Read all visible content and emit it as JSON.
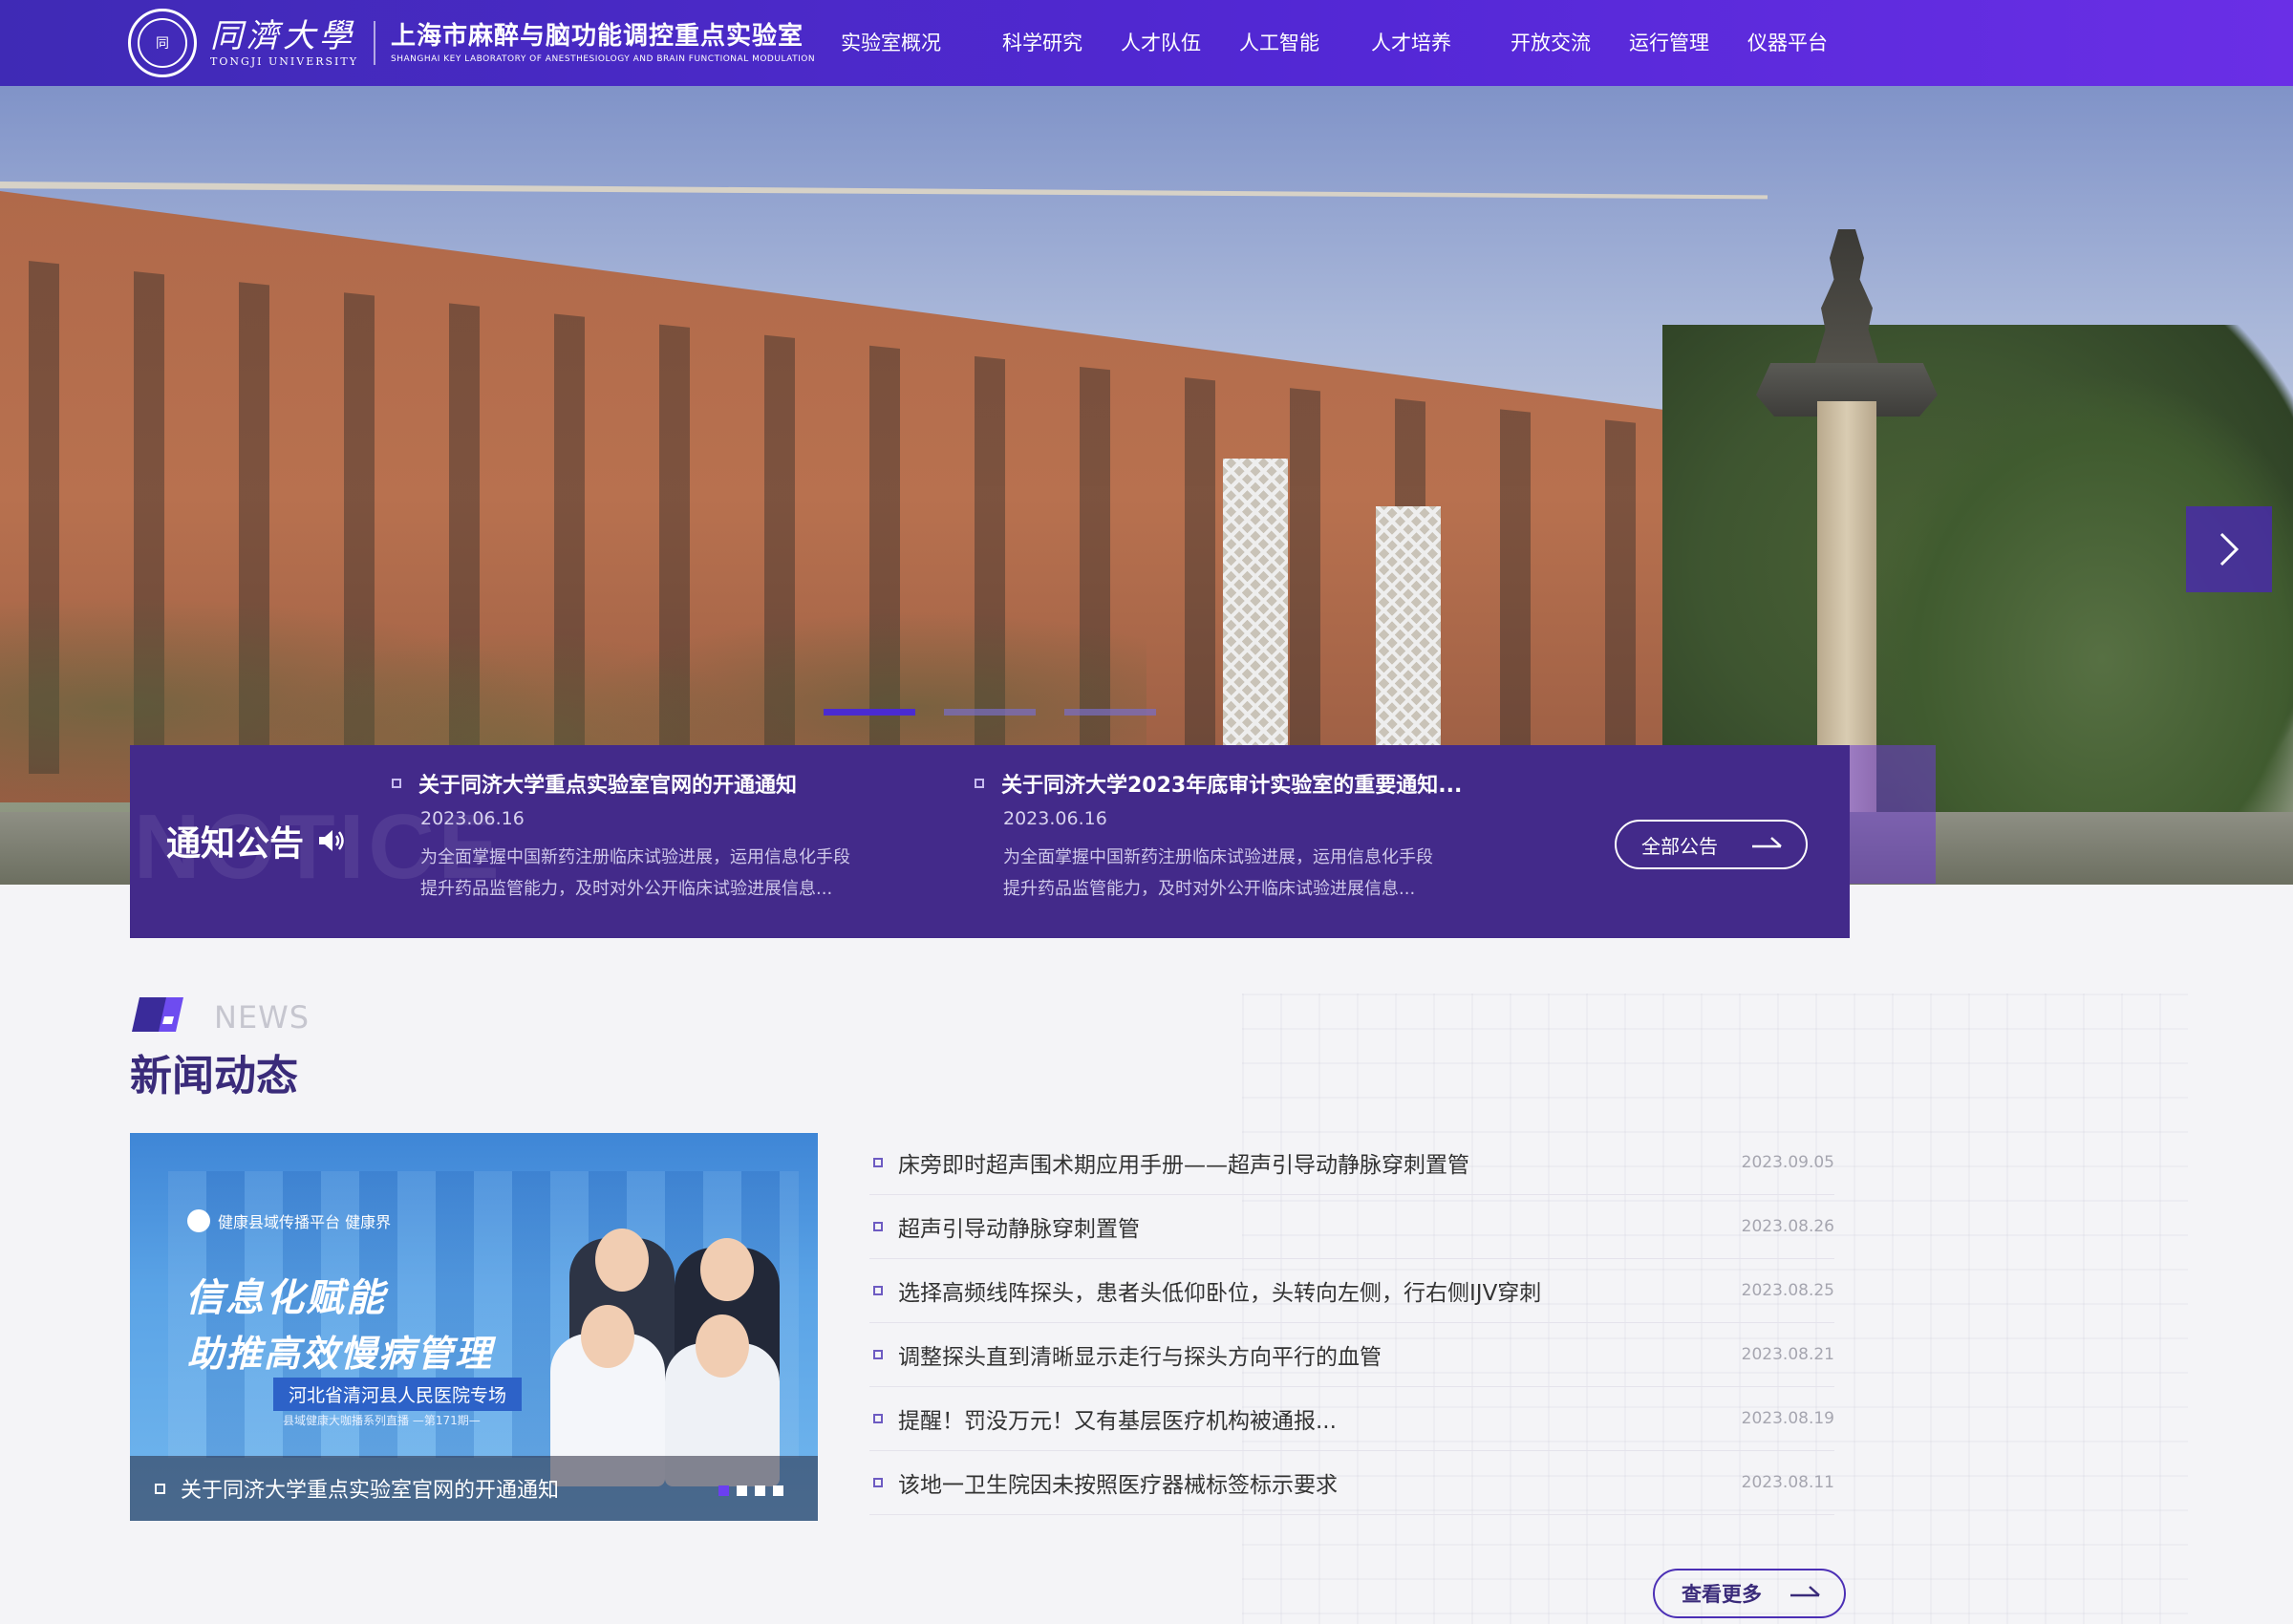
{
  "header": {
    "uni_cn": "同濟大學",
    "uni_en": "TONGJI UNIVERSITY",
    "lab_cn": "上海市麻醉与脑功能调控重点实验室",
    "lab_en": "SHANGHAI KEY LABORATORY OF ANESTHESIOLOGY AND BRAIN FUNCTIONAL MODULATION",
    "nav": [
      "实验室概况",
      "科学研究",
      "人才队伍",
      "人工智能",
      "人才培养",
      "开放交流",
      "运行管理",
      "仪器平台"
    ]
  },
  "hero": {
    "slide_count": 3,
    "active_slide": 1
  },
  "notice": {
    "ghost": "NOTICE",
    "title": "通知公告",
    "items": [
      {
        "title": "关于同济大学重点实验室官网的开通通知",
        "date": "2023.06.16",
        "summary1": "为全面掌握中国新药注册临床试验进展，运用信息化手段",
        "summary2": "提升药品监管能力，及时对外公开临床试验进展信息..."
      },
      {
        "title": "关于同济大学2023年底审计实验室的重要通知...",
        "date": "2023.06.16",
        "summary1": "为全面掌握中国新药注册临床试验进展，运用信息化手段",
        "summary2": "提升药品监管能力，及时对外公开临床试验进展信息..."
      }
    ],
    "more": "全部公告"
  },
  "news": {
    "en": "NEWS",
    "cn": "新闻动态",
    "feature": {
      "brand": "健康县域传播平台  健康界",
      "h1": "信息化赋能",
      "h2": "助推高效慢病管理",
      "tag": "河北省清河县人民医院专场",
      "sub": "县域健康大咖播系列直播 —第171期—",
      "caption": "关于同济大学重点实验室官网的开通通知",
      "slide_count": 3,
      "active_slide": 1
    },
    "list": [
      {
        "title": "床旁即时超声围术期应用手册——超声引导动静脉穿刺置管",
        "date": "2023.09.05"
      },
      {
        "title": "超声引导动静脉穿刺置管",
        "date": "2023.08.26"
      },
      {
        "title": "选择高频线阵探头，患者头低仰卧位，头转向左侧，行右侧IJV穿刺",
        "date": "2023.08.25"
      },
      {
        "title": "调整探头直到清晰显示走行与探头方向平行的血管",
        "date": "2023.08.21"
      },
      {
        "title": "提醒！罚没万元！又有基层医疗机构被通报...",
        "date": "2023.08.19"
      },
      {
        "title": "该地一卫生院因未按照医疗器械标签标示要求",
        "date": "2023.08.11"
      }
    ],
    "more": "查看更多"
  },
  "colors": {
    "header_start": "#3f2ab5",
    "header_end": "#6a2fe6",
    "notice_bg": "#432a8a",
    "title_purple": "#3a2b7a",
    "accent": "#4a2bd0"
  }
}
